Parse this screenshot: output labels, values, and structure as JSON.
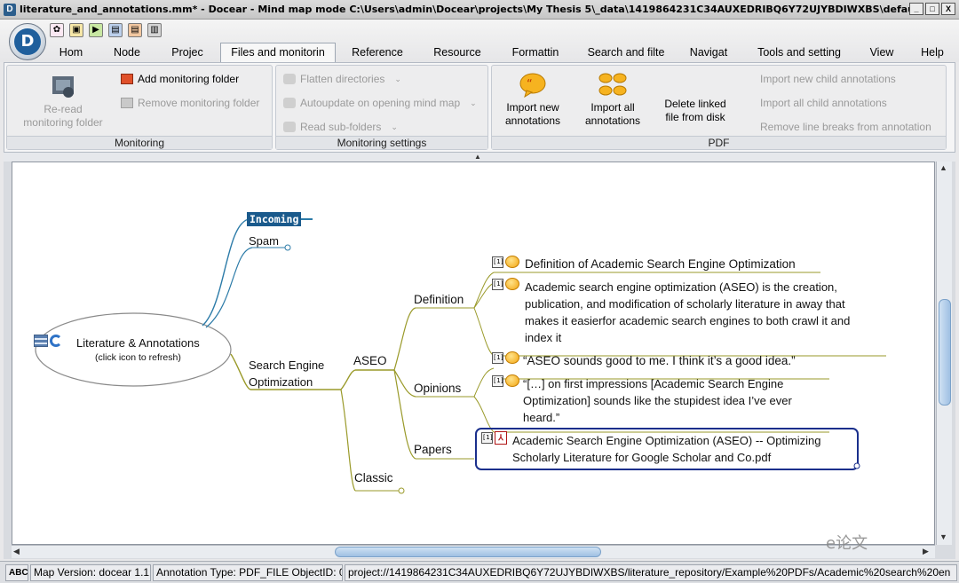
{
  "window": {
    "title": "literature_and_annotations.mm* - Docear - Mind map mode C:\\Users\\admin\\Docear\\projects\\My Thesis 5\\_data\\1419864231C34AUXEDRIBQ6Y72UJYBDIWXBS\\default_files\\li...",
    "app_icon": "docear-icon",
    "minimize": "_",
    "maximize": "□",
    "close": "X"
  },
  "tabs": [
    {
      "label": "Hom"
    },
    {
      "label": "Node"
    },
    {
      "label": "Projec"
    },
    {
      "label": "Files and monitorin"
    },
    {
      "label": "Reference"
    },
    {
      "label": "Resource"
    },
    {
      "label": "Formattin"
    },
    {
      "label": "Search and filte"
    },
    {
      "label": "Navigat"
    },
    {
      "label": "Tools and setting"
    },
    {
      "label": "View"
    },
    {
      "label": "Help"
    }
  ],
  "ribbon": {
    "monitoring": {
      "label": "Monitoring",
      "reread": "Re-read\nmonitoring folder",
      "add_folder": "Add monitoring folder",
      "remove_folder": "Remove monitoring folder"
    },
    "monitoring_settings": {
      "label": "Monitoring settings",
      "flatten": "Flatten directories",
      "autoupdate": "Autoupdate on opening mind map",
      "read_sub": "Read sub-folders"
    },
    "pdf": {
      "label": "PDF",
      "import_new": "Import new\nannotations",
      "import_all": "Import all\nannotations",
      "delete_linked": "Delete linked\nfile from disk",
      "import_new_child": "Import new child annotations",
      "import_all_child": "Import all child annotations",
      "remove_breaks": "Remove line breaks from annotation"
    }
  },
  "map": {
    "root": {
      "title": "Literature & Annotations",
      "subtitle": "(click icon to refresh)"
    },
    "incoming": "Incoming",
    "spam": "Spam",
    "seo": "Search Engine\nOptimization",
    "aseo": "ASEO",
    "classic": "Classic",
    "definition": "Definition",
    "opinions": "Opinions",
    "papers": "Papers",
    "annotations": {
      "def_title": "Definition of Academic Search Engine Optimization",
      "def_text": "Academic search engine optimization (ASEO) is the creation, publication, and modification of scholarly literature in away that makes it easierfor academic search engines to both crawl it and index it",
      "op1": "“ASEO sounds good to me. I think it’s a good idea.”",
      "op2": "“[…] on first impressions [Academic Search Engine Optimization] sounds like the stupidest idea I’ve ever heard.”",
      "paper": "Academic Search Engine Optimization (ASEO) -- Optimizing Scholarly Literature for Google Scholar and Co.pdf"
    },
    "colors": {
      "incoming_bg": "#1a5a8c",
      "branch_blue": "#2c7ba8",
      "branch_olive": "#9a9a2a",
      "selection": "#1a2f8c"
    }
  },
  "status": {
    "abc": "ABC",
    "version": "Map Version: docear 1.1",
    "annotation": "Annotation Type: PDF_FILE ObjectID: 0",
    "path": "project://1419864231C34AUXEDRIBQ6Y72UJYBDIWXBS/literature_repository/Example%20PDFs/Academic%20search%20en"
  },
  "watermark": "e论文"
}
